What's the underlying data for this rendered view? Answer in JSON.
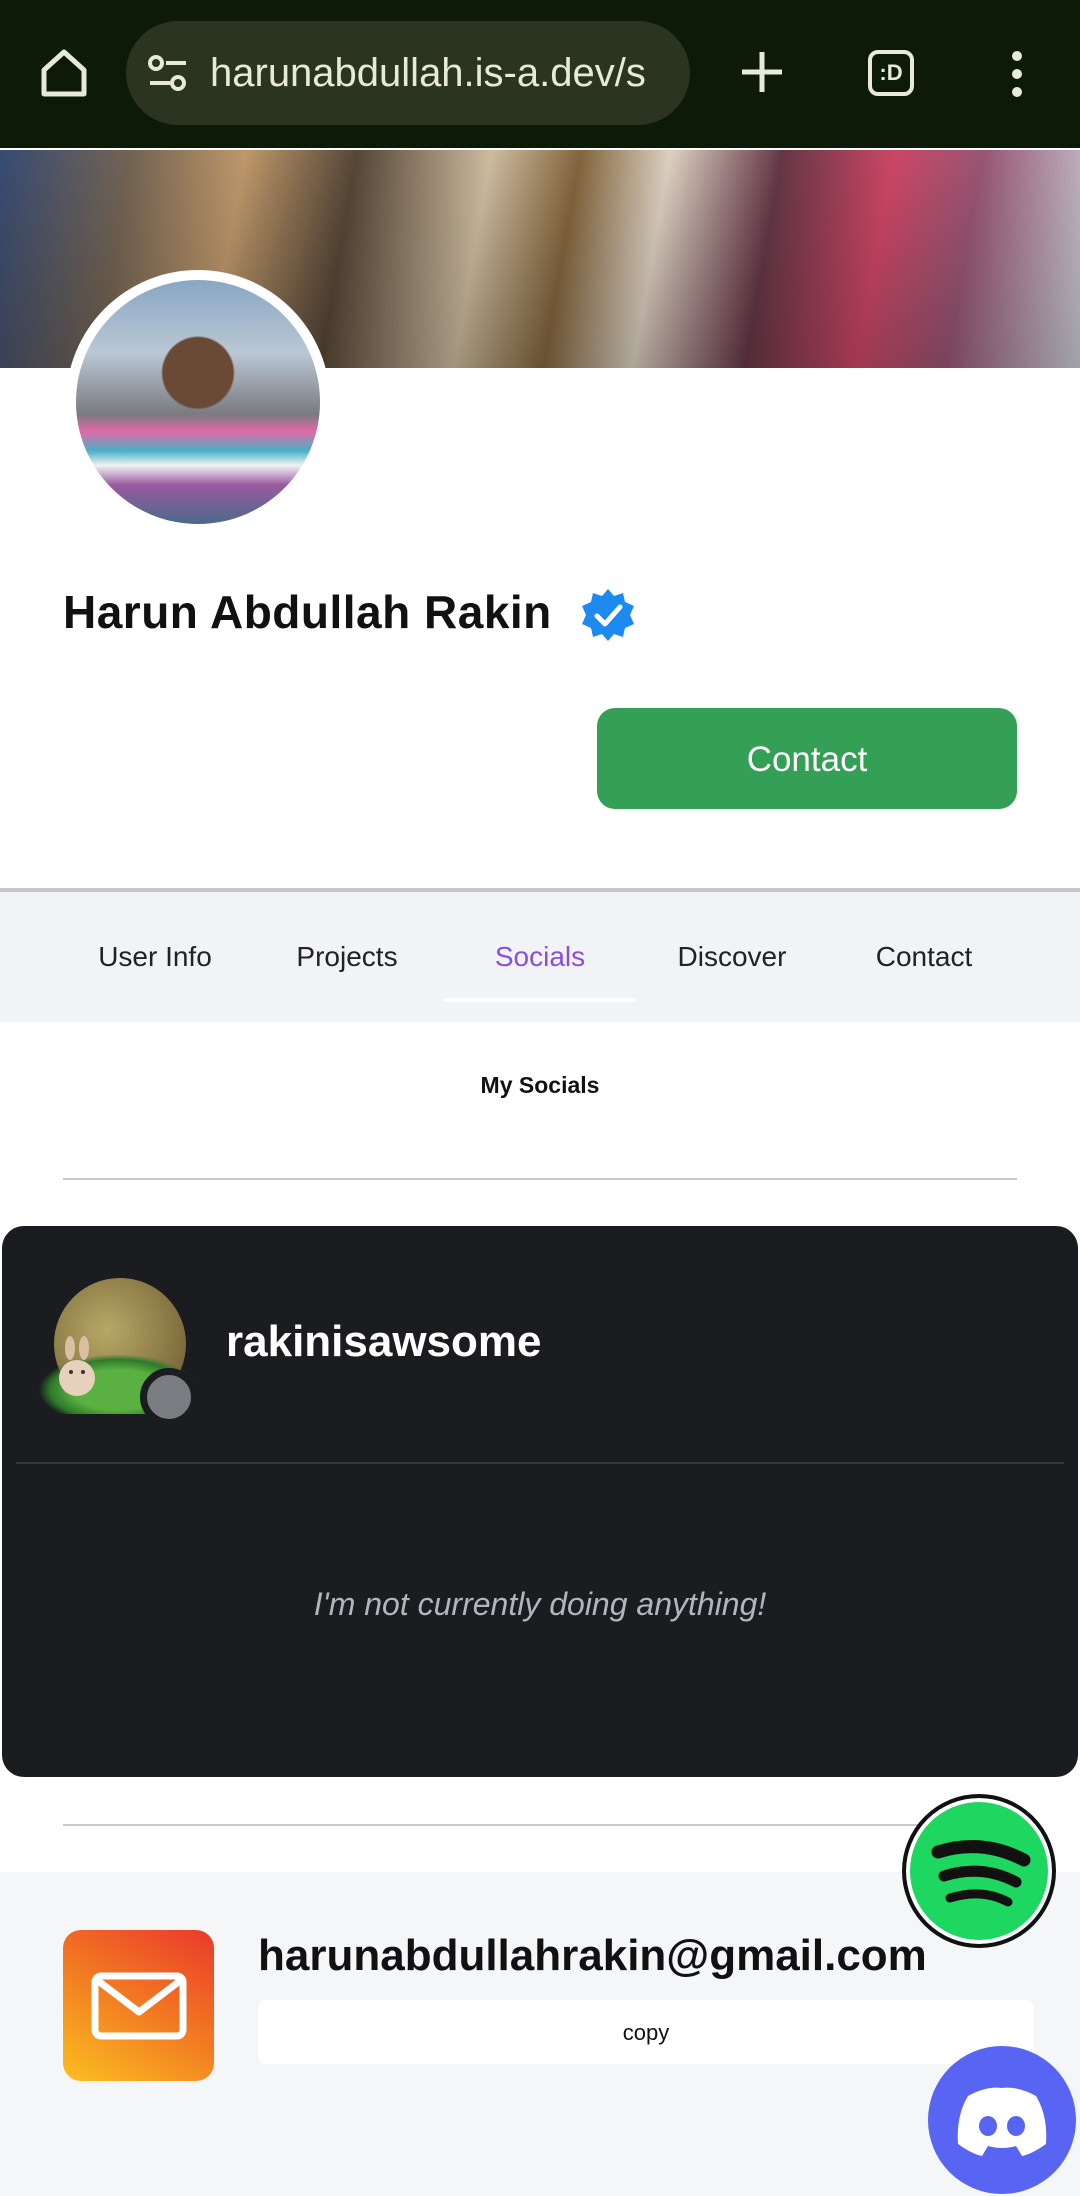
{
  "browser": {
    "url": "harunabdullah.is-a.dev/s",
    "tabs_icon_label": ":D"
  },
  "profile": {
    "name": "Harun Abdullah Rakin",
    "contact_button": "Contact"
  },
  "tabs": [
    {
      "label": "User Info",
      "active": false
    },
    {
      "label": "Projects",
      "active": false
    },
    {
      "label": "Socials",
      "active": true
    },
    {
      "label": "Discover",
      "active": false
    },
    {
      "label": "Contact",
      "active": false
    }
  ],
  "socials": {
    "title": "My Socials",
    "discord": {
      "username": "rakinisawsome",
      "activity": "I'm not currently doing anything!",
      "status_color": "#7a7c82"
    },
    "email": {
      "address": "harunabdullahrakin@gmail.com",
      "copy_label": "copy"
    }
  },
  "colors": {
    "accent": "#8a4ee0",
    "contact_green": "#34a055",
    "spotify_green": "#1ed760",
    "discord_blurple": "#5865f2"
  }
}
